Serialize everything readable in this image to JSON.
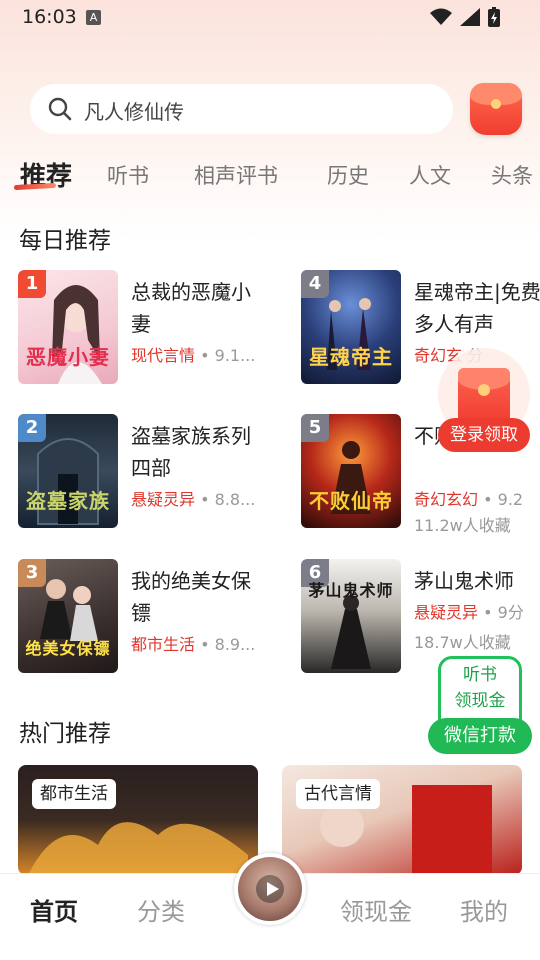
{
  "status_bar": {
    "time": "16:03",
    "notif_icon": "A"
  },
  "search": {
    "placeholder": "凡人修仙传"
  },
  "tabs": [
    {
      "label": "推荐",
      "active": true
    },
    {
      "label": "听书"
    },
    {
      "label": "相声评书"
    },
    {
      "label": "历史"
    },
    {
      "label": "人文"
    },
    {
      "label": "头条"
    }
  ],
  "daily": {
    "title": "每日推荐",
    "books": [
      {
        "rank": "1",
        "name": "总裁的恶魔小妻",
        "category": "现代言情",
        "score": "9.1...",
        "favorites": "",
        "cover_title": "恶魔小妻"
      },
      {
        "rank": "2",
        "name": "盗墓家族系列四部",
        "category": "悬疑灵异",
        "score": "8.8...",
        "favorites": "",
        "cover_title": "盗墓家族"
      },
      {
        "rank": "3",
        "name": "我的绝美女保镖",
        "category": "都市生活",
        "score": "8.9...",
        "favorites": "",
        "cover_title": "绝美女保镖"
      },
      {
        "rank": "4",
        "name": "星魂帝主|免费多人有声",
        "category": "奇幻玄",
        "score": "分",
        "favorites": "",
        "cover_title": "星魂帝主"
      },
      {
        "rank": "5",
        "name": "不败仙帝",
        "category": "奇幻玄幻",
        "score": "9.2",
        "favorites": "11.2w人收藏",
        "cover_title": "不败仙帝"
      },
      {
        "rank": "6",
        "name": "茅山鬼术师",
        "category": "悬疑灵异",
        "score": "9分",
        "favorites": "18.7w人收藏",
        "cover_title": "茅山鬼术师"
      }
    ]
  },
  "float_envelope": {
    "label": "登录领取"
  },
  "cash_widget": {
    "line1": "听书",
    "line2": "领现金",
    "button": "微信打款"
  },
  "hot": {
    "title": "热门推荐",
    "cards": [
      {
        "tag": "都市生活"
      },
      {
        "tag": "古代言情"
      }
    ]
  },
  "bottom_nav": [
    {
      "label": "首页",
      "active": true
    },
    {
      "label": "分类"
    },
    {
      "label": "领现金"
    },
    {
      "label": "我的"
    }
  ],
  "colors": {
    "accent": "#e0362c",
    "green": "#21b955"
  }
}
